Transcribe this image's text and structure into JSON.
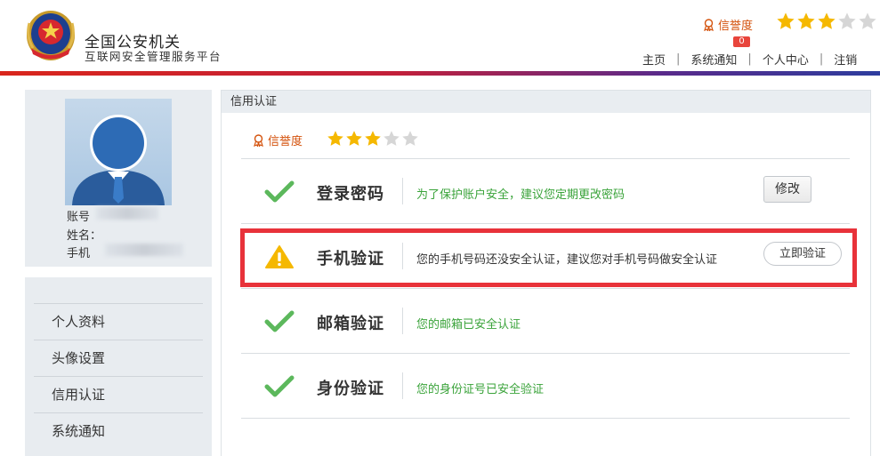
{
  "header": {
    "title": "全国公安机关",
    "subtitle": "互联网安全管理服务平台",
    "credit_label": "信誉度",
    "stars_filled": 3,
    "stars_total": 5,
    "notification_count": "0",
    "nav": [
      {
        "label": "主页"
      },
      {
        "label": "系统通知"
      },
      {
        "label": "个人中心"
      },
      {
        "label": "注销"
      }
    ],
    "nav_separator": "|"
  },
  "profile": {
    "account_label": "账号",
    "name_label": "姓名：",
    "phone_label": "手机"
  },
  "sidebar": {
    "items": [
      {
        "label": "个人资料"
      },
      {
        "label": "头像设置"
      },
      {
        "label": "信用认证"
      },
      {
        "label": "系统通知"
      }
    ]
  },
  "main": {
    "panel_title": "信用认证",
    "credit_label": "信誉度",
    "stars_filled": 3,
    "stars_total": 5,
    "items": [
      {
        "title": "登录密码",
        "status": "ok",
        "description": "为了保护账户安全，建议您定期更改密码",
        "button": "修改"
      },
      {
        "title": "手机验证",
        "status": "warning",
        "description": "您的手机号码还没安全认证，建议您对手机号码做安全认证",
        "button": "立即验证"
      },
      {
        "title": "邮箱验证",
        "status": "ok",
        "description": "您的邮箱已安全认证"
      },
      {
        "title": "身份验证",
        "status": "ok",
        "description": "您的身份证号已安全验证"
      }
    ]
  },
  "colors": {
    "star_filled": "#f5b800",
    "star_empty": "#d6d6d6",
    "check_green": "#5cb85c",
    "warning_yellow": "#f5b800",
    "highlight_red": "#e8323a",
    "credit_orange": "#d4520c"
  }
}
